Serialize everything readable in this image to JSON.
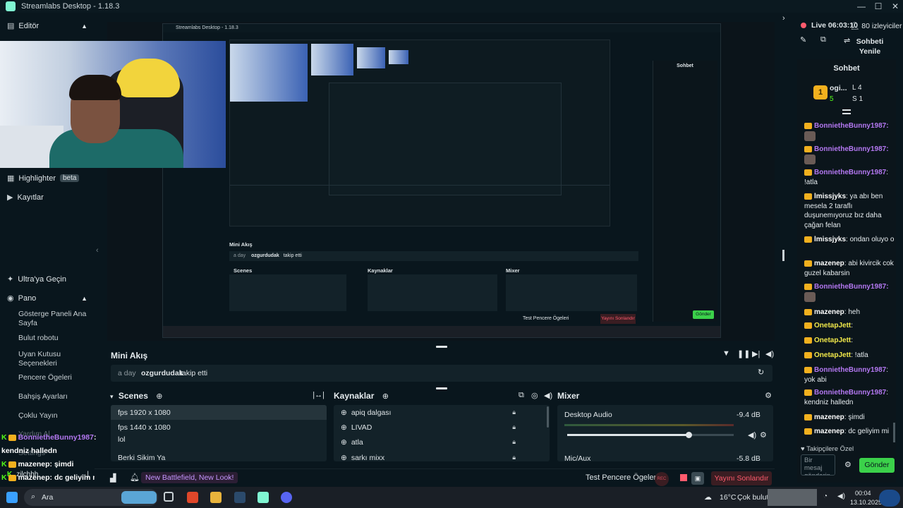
{
  "window": {
    "title": "Streamlabs Desktop - 1.18.3"
  },
  "sidebar": {
    "editor_label": "Editör",
    "highlighter_label": "Highlighter",
    "highlighter_badge": "beta",
    "recordings_label": "Kayıtlar",
    "ultra_label": "Ultra'ya Geçin",
    "pano_label": "Pano",
    "pano_items": [
      "Gösterge Paneli Ana Sayfa",
      "Bulut robotu",
      "Uyan Kutusu Seçenekleri",
      "Pencere Ögeleri",
      "Bahşiş Ayarları",
      "Çoklu Yayın",
      "Yardım Al",
      "Settings"
    ],
    "zilch_label": "zilchhh"
  },
  "overlay_chat": [
    {
      "user": "BonnietheBunny1987",
      "text": ": kendniz halledn"
    },
    {
      "user": "mazenep",
      "text": ": şimdi"
    },
    {
      "user": "mazenep",
      "text": ": dc geliyim mi"
    }
  ],
  "nested_preview": {
    "title": "Streamlabs Desktop - 1.18.3",
    "mini_akis": "Mini Akış",
    "feed_time": "a day",
    "feed_user": "ozgurdudak",
    "feed_text": "takip etti",
    "scenes": "Scenes",
    "sources": "Kaynaklar",
    "mixer": "Mixer",
    "test_label": "Test Pencere Ögeleri",
    "stop_label": "Yayını Sonlandır",
    "send": "Gönder"
  },
  "mini_akis": {
    "title": "Mini Akış",
    "feed_time": "a day",
    "feed_user": "ozgurdudak",
    "feed_text": "takip etti"
  },
  "scenes": {
    "title": "Scenes",
    "items": [
      "fps 1920 x 1080",
      "fps 1440 x 1080",
      "lol",
      "Berki Sikim Ya"
    ]
  },
  "sources": {
    "title": "Kaynaklar",
    "items": [
      "apiq dalgası",
      "LIVAD",
      "atla",
      "sarkı mixx"
    ]
  },
  "mixer": {
    "title": "Mixer",
    "channel1_name": "Desktop Audio",
    "channel1_level": "-9.4 dB",
    "channel1_slider": 0.73,
    "channel2_name": "Mic/Aux",
    "channel2_level": "-5.8 dB"
  },
  "footer": {
    "notification": "New Battlefield, New Look!",
    "test_label": "Test Pencere Ögeleri",
    "rec_label": "REC",
    "stop_label": "Yayını Sonlandır"
  },
  "right_panel": {
    "live_time": "Live 06:03:10",
    "viewers": "80 izleyiciler",
    "refresh_label": "Sohbeti Yenile",
    "chat_title": "Sohbet",
    "top_user": "ogi...",
    "stat_l": "L 4",
    "stat_5": "5",
    "stat_s": "S 1",
    "followers_only": "Takipçilere Özel",
    "input_placeholder": "Bir mesaj gönderin",
    "send_label": "Gönder"
  },
  "chat_messages": [
    {
      "user": "BonnietheBunny1987",
      "text": ":",
      "color": "p",
      "sticker": true
    },
    {
      "user": "BonnietheBunny1987",
      "text": ":",
      "color": "p",
      "sticker": true
    },
    {
      "user": "BonnietheBunny1987",
      "text": ": !atla",
      "color": "p"
    },
    {
      "user": "lmissjyks",
      "text": ": ya abı ben mesela 2 taraflı duşunemıyoruz bız daha çağan felan",
      "color": "w"
    },
    {
      "user": "lmissjyks",
      "text": ": ondan oluyo o",
      "color": "w"
    },
    {
      "user": "mazenep",
      "text": ": abi kivircik cok guzel kabarsin",
      "color": "w"
    },
    {
      "user": "BonnietheBunny1987",
      "text": ":",
      "color": "p",
      "sticker": true
    },
    {
      "user": "mazenep",
      "text": ": heh",
      "color": "w"
    },
    {
      "user": "OnetapJett",
      "text": ":",
      "color": "y"
    },
    {
      "user": "OnetapJett",
      "text": ":",
      "color": "y"
    },
    {
      "user": "OnetapJett",
      "text": ": !atla",
      "color": "y"
    },
    {
      "user": "BonnietheBunny1987",
      "text": ": yok abi",
      "color": "p"
    },
    {
      "user": "BonnietheBunny1987",
      "text": ": kendniz halledn",
      "color": "p"
    },
    {
      "user": "mazenep",
      "text": ": şimdi",
      "color": "w"
    },
    {
      "user": "mazenep",
      "text": ": dc geliyim mi",
      "color": "w"
    }
  ],
  "taskbar": {
    "search_label": "Ara",
    "weather": "16°C",
    "weather_text": "Çok bulutlu",
    "time": "00:04",
    "date": "13.10.2025"
  },
  "colors": {
    "accent": "#80f5d2",
    "danger": "#ff5b6d",
    "purple_user": "#b478f2",
    "send_green": "#3bd14a"
  }
}
